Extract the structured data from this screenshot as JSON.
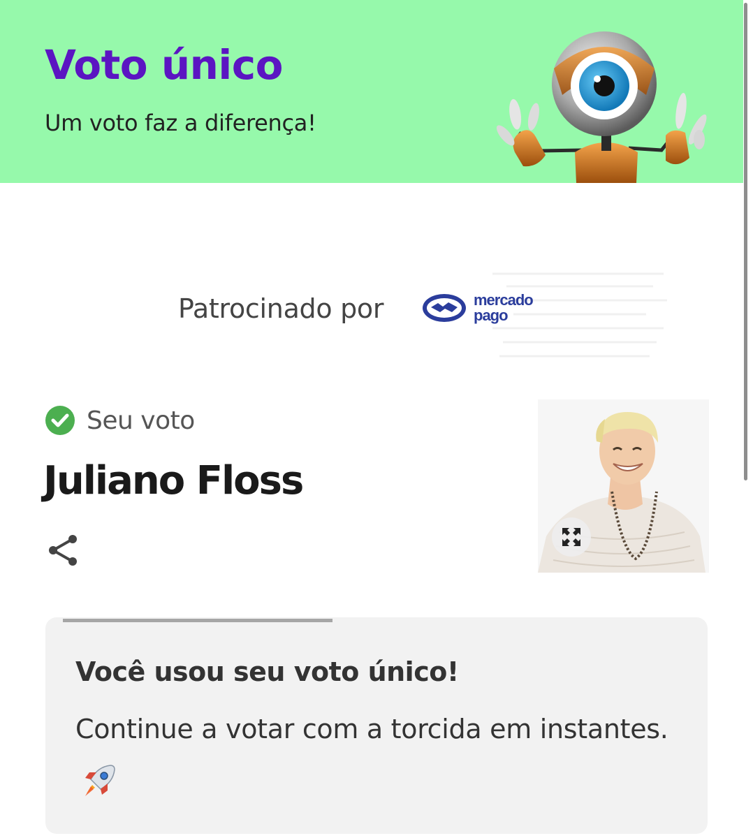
{
  "header": {
    "title": "Voto único",
    "subtitle": "Um voto faz a diferença!",
    "background_color": "#96f9ab",
    "title_color": "#5b15c2",
    "mascot_icon": "big-brother-eye-mascot"
  },
  "sponsor": {
    "label": "Patrocinado por",
    "logo_text_line1": "mercado",
    "logo_text_line2": "pago",
    "logo_icon": "handshake-icon",
    "logo_color": "#2b3d9c"
  },
  "vote": {
    "status_label": "Seu voto",
    "status_icon": "check-circle-icon",
    "check_color": "#4caf50",
    "candidate_name": "Juliano Floss",
    "share_icon": "share-icon",
    "expand_icon": "expand-icon"
  },
  "message": {
    "title": "Você usou seu voto único!",
    "body": "Continue a votar com a torcida em instantes.",
    "emoji": "rocket-icon",
    "progress_fraction": 0.42
  }
}
